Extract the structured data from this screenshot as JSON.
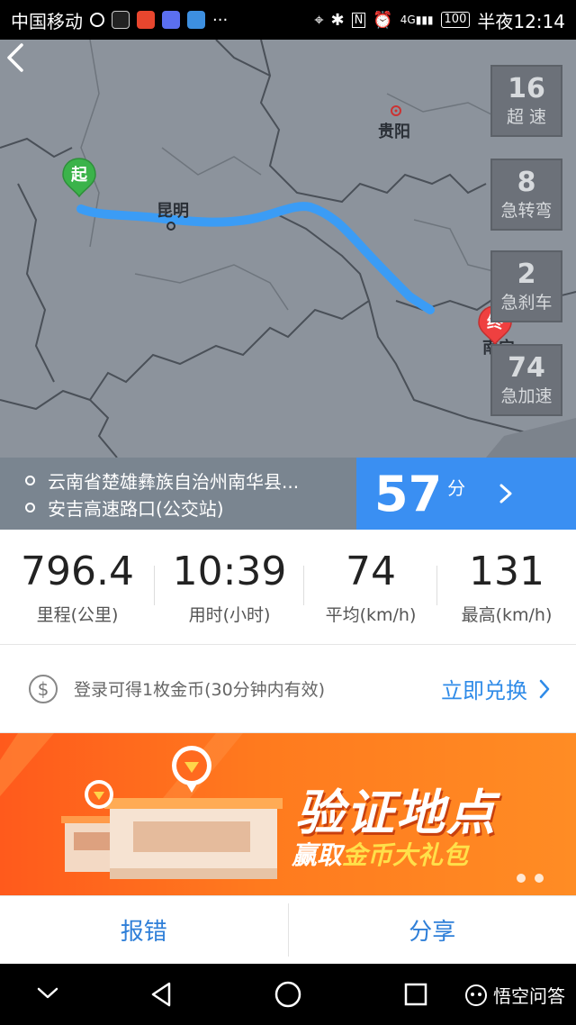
{
  "status_bar": {
    "carrier": "中国移动",
    "network": "4G",
    "battery": "100",
    "time": "半夜12:14"
  },
  "map": {
    "cities": [
      "贵阳",
      "昆明",
      "南宁"
    ],
    "start_marker": "起",
    "end_marker": "终",
    "stat_cards": [
      {
        "value": "16",
        "label": "超 速"
      },
      {
        "value": "8",
        "label": "急转弯"
      },
      {
        "value": "2",
        "label": "急刹车"
      },
      {
        "value": "74",
        "label": "急加速"
      }
    ]
  },
  "route": {
    "start_address": "云南省楚雄彝族自治州南华县...",
    "end_address": "安吉高速路口(公交站)",
    "duration_value": "57",
    "duration_unit": "分"
  },
  "stats": [
    {
      "value": "796.4",
      "label": "里程(公里)"
    },
    {
      "value": "10:39",
      "label": "用时(小时)"
    },
    {
      "value": "74",
      "label": "平均(km/h)"
    },
    {
      "value": "131",
      "label": "最高(km/h)"
    }
  ],
  "coin": {
    "text": "登录可得1枚金币(30分钟内有效)",
    "action": "立即兑换"
  },
  "banner": {
    "title": "验证地点",
    "subtitle_pre": "赢取",
    "subtitle_hl": "金币大礼包"
  },
  "actions": {
    "report": "报错",
    "share": "分享"
  },
  "watermark": "悟空问答",
  "colors": {
    "accent": "#3a8ff2",
    "route": "#3b9cf5",
    "banner": "#ff6a1f",
    "start_pin": "#3bb34a",
    "end_pin": "#ef4040"
  }
}
